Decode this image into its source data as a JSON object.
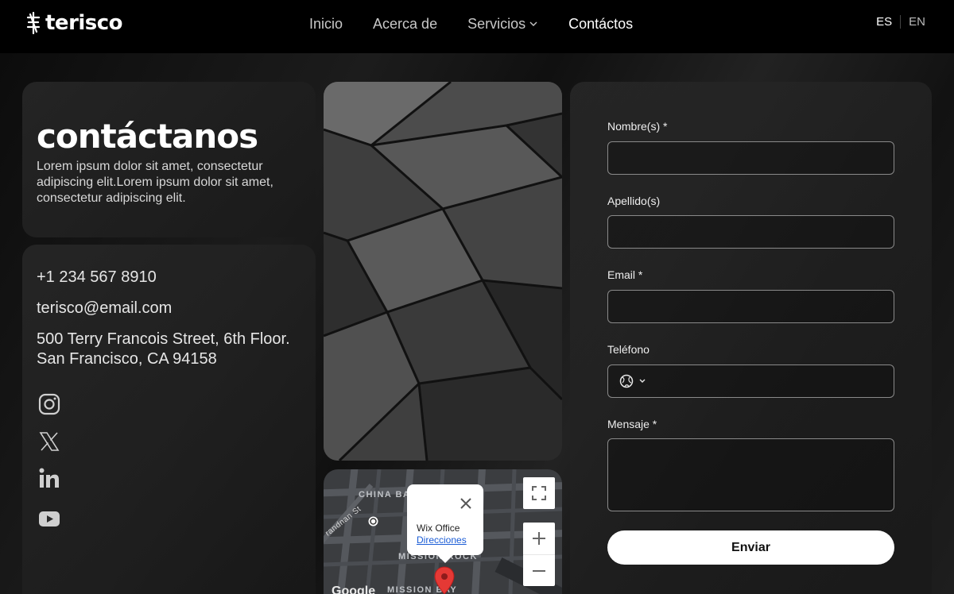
{
  "header": {
    "brand": "terisco",
    "nav": [
      {
        "label": "Inicio"
      },
      {
        "label": "Acerca de"
      },
      {
        "label": "Servicios"
      },
      {
        "label": "Contáctos"
      }
    ],
    "lang": {
      "es": "ES",
      "en": "EN"
    }
  },
  "intro": {
    "title": "contáctanos",
    "description": "Lorem ipsum dolor sit amet, consectetur adipiscing elit.Lorem ipsum dolor sit amet, consectetur adipiscing elit."
  },
  "info": {
    "phone": "+1 234 567 8910",
    "email": "terisco@email.com",
    "address_line1": "500 Terry Francois Street, 6th Floor.",
    "address_line2": "San Francisco, CA 94158",
    "social": [
      "instagram-icon",
      "x-icon",
      "linkedin-icon",
      "youtube-icon"
    ]
  },
  "map": {
    "labels": {
      "china": "CHINA BA",
      "st": "randnan St",
      "mission_rock": "MISSION ROCK",
      "mission_bay": "MISSION BAY",
      "google": "Google"
    },
    "popup_title": "Wix Office",
    "popup_link": "Direcciones"
  },
  "form": {
    "fields": [
      {
        "label": "Nombre(s) *"
      },
      {
        "label": "Apellido(s)"
      },
      {
        "label": "Email *"
      },
      {
        "label": "Teléfono"
      },
      {
        "label": "Mensaje *"
      }
    ],
    "submit": "Enviar"
  },
  "colors": {
    "accent": "#ffffff",
    "background": "#0a0a0a",
    "map_link": "#1a5cd6"
  }
}
